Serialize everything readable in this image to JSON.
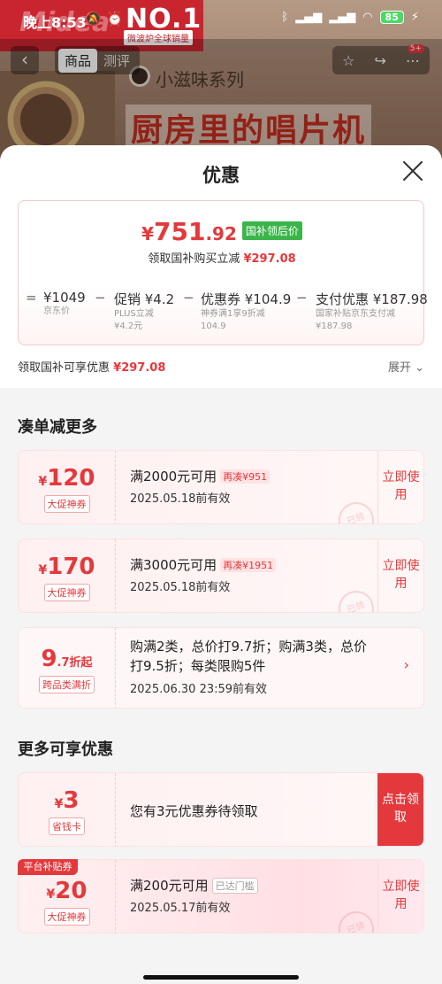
{
  "status_bar": {
    "time": "晚上8:53",
    "battery": "85"
  },
  "background_page": {
    "brand": "Midea",
    "no1": "NO.1",
    "no1_sub": "微波炉全球销量",
    "tab_active": "商品",
    "tab_inactive": "测评",
    "series": "小滋味系列",
    "headline": "厨房里的唱片机",
    "badge": "5+"
  },
  "sheet": {
    "title": "优惠",
    "price": {
      "yen": "¥",
      "integer": "751",
      "decimal": ".92",
      "tag": "国补领后价",
      "sub_text": "领取国补购买立减",
      "sub_amount": "¥297.08"
    },
    "breakdown": [
      {
        "op": "=",
        "main": "¥1049",
        "note1": "京东价",
        "note2": ""
      },
      {
        "op": "−",
        "main": "促销 ¥4.2",
        "note1": "PLUS立减",
        "note2": "¥4.2元"
      },
      {
        "op": "−",
        "main": "优惠券 ¥104.9",
        "note1": "神券满1享9折减",
        "note2": "104.9"
      },
      {
        "op": "−",
        "main": "支付优惠 ¥187.98",
        "note1": "国家补贴京东支付减",
        "note2": "¥187.98"
      }
    ],
    "saving_text": "领取国补可享优惠",
    "saving_amount": "¥297.08",
    "expand_label": "展开"
  },
  "section1_title": "凑单减更多",
  "section2_title": "更多可享优惠",
  "coupons": [
    {
      "yen": "¥",
      "amount": "120",
      "tag": "大促神券",
      "title": "满2000元可用",
      "chip": "再凑¥951",
      "date": "2025.05.18前有效",
      "action": "立即使用",
      "stamp": "已领"
    },
    {
      "yen": "¥",
      "amount": "170",
      "tag": "大促神券",
      "title": "满3000元可用",
      "chip": "再凑¥1951",
      "date": "2025.05.18前有效",
      "action": "立即使用",
      "stamp": "已领"
    }
  ],
  "discount_coupon": {
    "amount": "9",
    "suffix": ".7折起",
    "tag": "跨品类满折",
    "desc_line1": "购满2类，总价打9.7折；购满3类，总价",
    "desc_line2": "打9.5折；每类限购5件",
    "date": "2025.06.30 23:59前有效",
    "chevron": "›"
  },
  "more_coupons": [
    {
      "yen": "¥",
      "amount": "3",
      "tag": "省钱卡",
      "title": "您有3元优惠券待领取",
      "action": "点击领取"
    },
    {
      "label": "平台补贴券",
      "yen": "¥",
      "amount": "20",
      "tag": "大促神券",
      "title": "满200元可用",
      "chip": "已达门槛",
      "date": "2025.05.17前有效",
      "action": "立即使用",
      "stamp": "已领"
    }
  ],
  "colors": {
    "accent": "#e4393c",
    "green_tag": "#3bb54a"
  }
}
